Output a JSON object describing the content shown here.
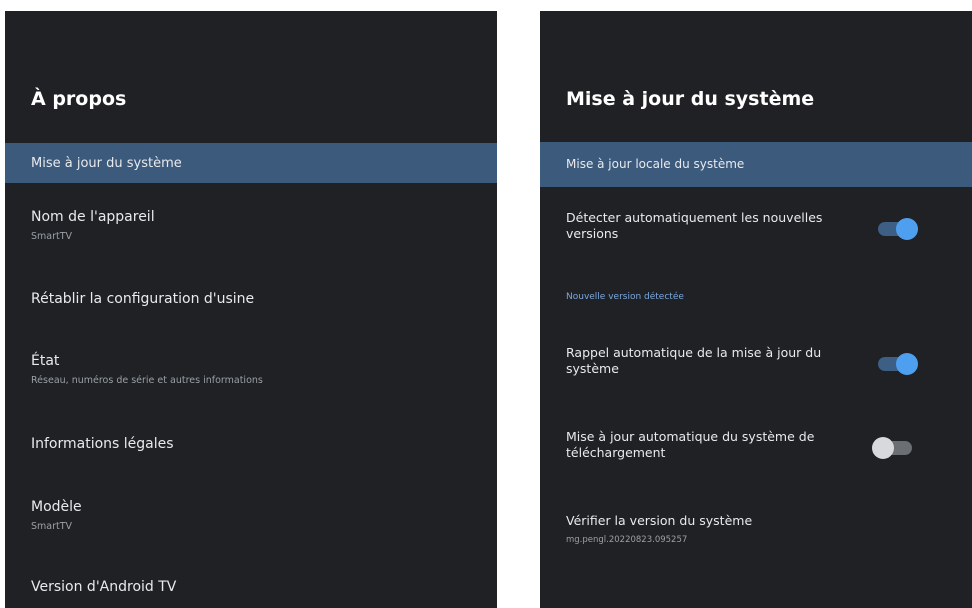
{
  "left": {
    "title": "À propos",
    "items": [
      {
        "label": "Mise à jour du système",
        "sub": ""
      },
      {
        "label": "Nom de l'appareil",
        "sub": "SmartTV"
      },
      {
        "label": "Rétablir la configuration d'usine",
        "sub": ""
      },
      {
        "label": "État",
        "sub": "Réseau, numéros de série et autres informations"
      },
      {
        "label": "Informations légales",
        "sub": ""
      },
      {
        "label": "Modèle",
        "sub": "SmartTV"
      },
      {
        "label": "Version d'Android TV",
        "sub": ""
      }
    ]
  },
  "right": {
    "title": "Mise à jour du système",
    "local_update_label": "Mise à jour locale du système",
    "auto_detect": {
      "label": "Détecter automatiquement les nouvelles versions",
      "state": "on"
    },
    "section_header": "Nouvelle version détectée",
    "auto_reminder": {
      "label": "Rappel automatique de la mise à jour du système",
      "state": "on"
    },
    "auto_download": {
      "label": "Mise à jour automatique du système de téléchargement",
      "state": "off"
    },
    "verify": {
      "label": "Vérifier la version du système",
      "sub": "mg.pengl.20220823.095257"
    }
  },
  "colors": {
    "panel_bg": "#202124",
    "selected_bg": "#3c5a7c",
    "accent": "#4f9ff0"
  }
}
